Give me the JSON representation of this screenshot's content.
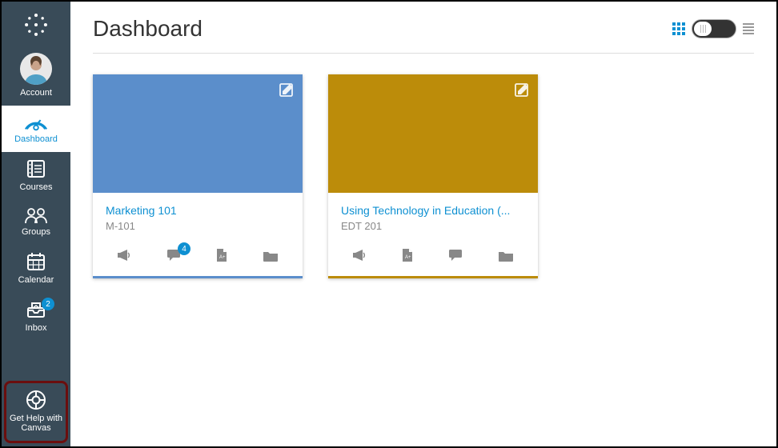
{
  "header": {
    "title": "Dashboard"
  },
  "sidebar": {
    "items": [
      {
        "id": "account",
        "label": "Account"
      },
      {
        "id": "dashboard",
        "label": "Dashboard"
      },
      {
        "id": "courses",
        "label": "Courses"
      },
      {
        "id": "groups",
        "label": "Groups"
      },
      {
        "id": "calendar",
        "label": "Calendar"
      },
      {
        "id": "inbox",
        "label": "Inbox",
        "badge": "2"
      },
      {
        "id": "help",
        "label": "Get Help with Canvas"
      }
    ]
  },
  "courses": [
    {
      "title": "Marketing 101",
      "code": "M-101",
      "color": "#5B8ECB",
      "discussion_badge": "4"
    },
    {
      "title": "Using Technology in Education (...",
      "code": "EDT 201",
      "color": "#BC8C0A"
    }
  ]
}
